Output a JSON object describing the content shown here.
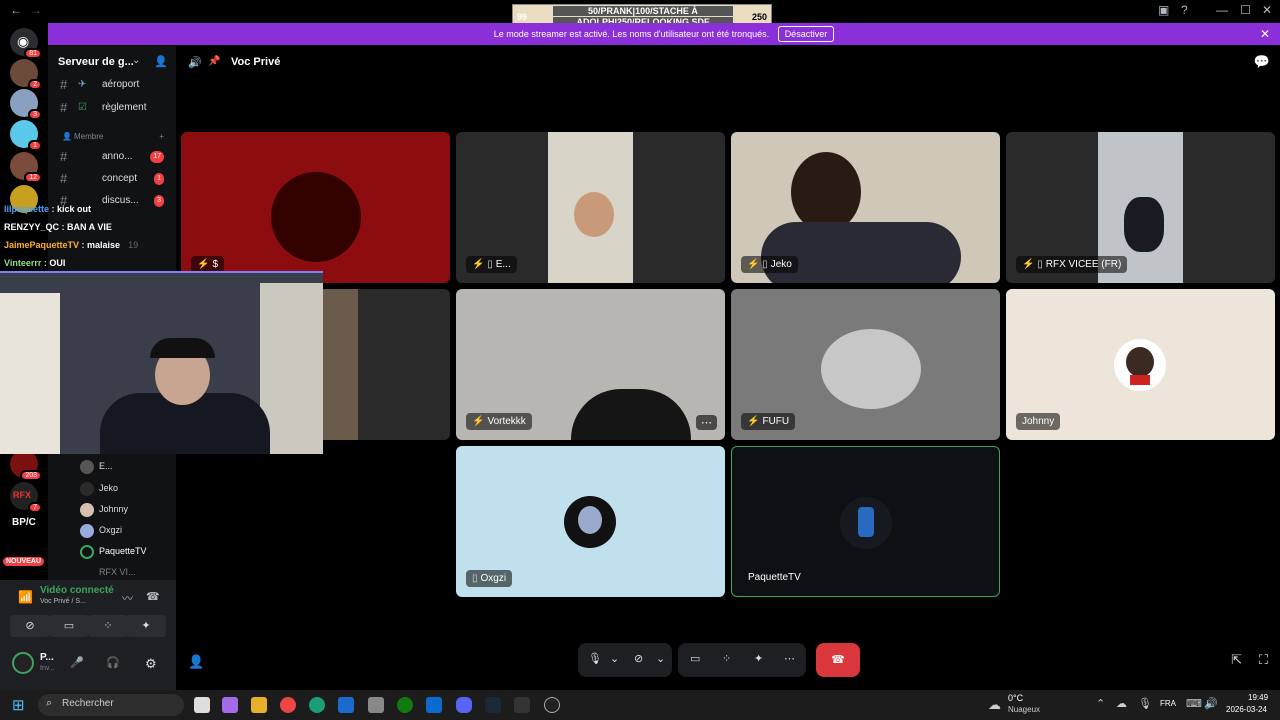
{
  "overlay": {
    "left_num": "99",
    "line1": "50/PRANK|100/STACHE À",
    "line2": "ADOLPH|250/RELOOKING SDF",
    "right_num": "250"
  },
  "banner": {
    "text": "Le mode streamer est activé. Les noms d'utilisateur ont été tronqués.",
    "button": "Désactiver"
  },
  "server": {
    "name": "Serveur de g...",
    "servers": [
      {
        "badge": "81"
      },
      {
        "badge": "2"
      },
      {
        "badge": "3"
      },
      {
        "badge": "1"
      },
      {
        "badge": "12"
      },
      {
        "badge": "203"
      },
      {
        "badge": "7"
      },
      {
        "label": "BP/C"
      },
      {
        "label": "NOUVEAU"
      }
    ]
  },
  "channels": [
    {
      "name": "aéroport"
    },
    {
      "name": "règlement"
    },
    {
      "name": "Membre",
      "category": true
    },
    {
      "name": "anno...",
      "count": "17"
    },
    {
      "name": "concept",
      "count": "1"
    },
    {
      "name": "discus...",
      "count": "3"
    }
  ],
  "voice_members": [
    "E...",
    "Jeko",
    "Johnny",
    "Oxgzi",
    "PaquetteTV",
    "RFX VI..."
  ],
  "chat": [
    {
      "user": "lilpaquette",
      "msg": "kick out",
      "color": "#4aa3ff"
    },
    {
      "user": "RENZYY_QC",
      "msg": "BAN A VIE",
      "color": "#ffffff"
    },
    {
      "user": "JaimePaquetteTV",
      "msg": "malaise",
      "color": "#ffb02e"
    },
    {
      "user": "Vinteerrr",
      "msg": "OUI",
      "color": "#8be08b"
    }
  ],
  "chat_extra": "19",
  "voice_header": {
    "title": "Voc Privé"
  },
  "tiles": [
    {
      "name": "$"
    },
    {
      "name": "E..."
    },
    {
      "name": "Jeko"
    },
    {
      "name": "RFX VICEE (FR)"
    },
    {
      "name": ""
    },
    {
      "name": "Vortekkk"
    },
    {
      "name": "FUFU"
    },
    {
      "name": "Johnny"
    },
    {
      "name": "Oxgzi"
    },
    {
      "name": "PaquetteTV"
    }
  ],
  "user_panel": {
    "status": "Vidéo connecté",
    "sub": "Voc Privé / S...",
    "user": "P...",
    "user_sub": "Inv..."
  },
  "taskbar": {
    "search": "Rechercher",
    "weather_temp": "0°C",
    "weather_desc": "Nuageux",
    "lang": "FRA",
    "time": "19:49",
    "date": "2026-03-24"
  }
}
